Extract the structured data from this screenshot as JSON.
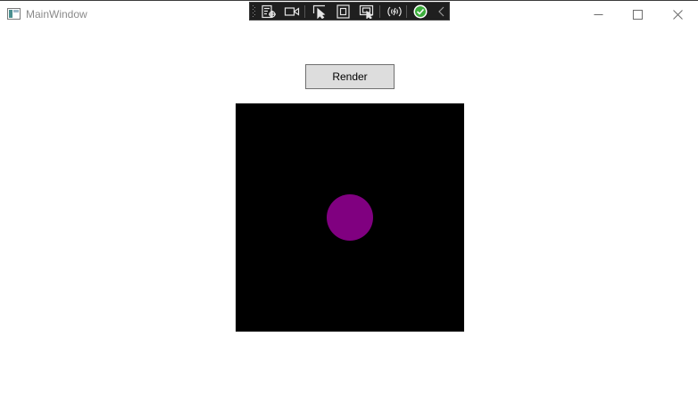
{
  "window": {
    "title": "MainWindow"
  },
  "toolbar": {
    "icons": [
      "live-visual-tree-icon",
      "record-icon",
      "select-element-icon",
      "display-layout-adorners-icon",
      "track-focus-icon",
      "hot-reload-icon",
      "binding-status-ok-icon",
      "collapse-toolbar-icon"
    ]
  },
  "main": {
    "render_label": "Render"
  },
  "colors": {
    "canvas": "#000000",
    "circle": "#800080",
    "toolbar_bg": "#1f1f1f",
    "ok_green": "#3cae3c"
  }
}
